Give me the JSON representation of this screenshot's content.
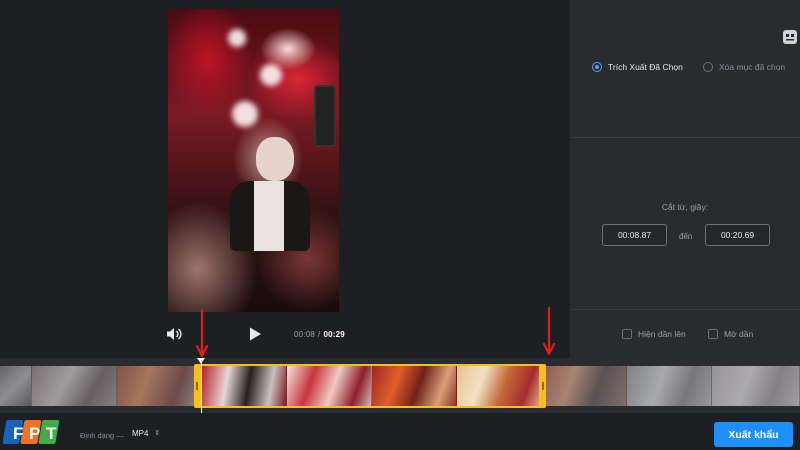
{
  "player": {
    "current_time": "00:08",
    "separator": "/",
    "total_time": "00:29"
  },
  "options": {
    "mode_extract_label": "Trích Xuất Đã Chọn",
    "mode_delete_label": "Xóa mục đã chọn",
    "selected_mode": "extract"
  },
  "cut": {
    "label": "Cắt từ, giây:",
    "start": "00:08.87",
    "to_label": "đến",
    "end": "00:20.69"
  },
  "effects": {
    "fade_in_label": "Hiện dần lên",
    "fade_out_label": "Mờ dần",
    "fade_in_checked": false,
    "fade_out_checked": false
  },
  "format": {
    "label": "Định dạng —",
    "value": "MP4"
  },
  "export": {
    "label": "Xuất khẩu"
  },
  "logo": {
    "letters": [
      "F",
      "P",
      "T"
    ]
  },
  "colors": {
    "accent": "#1f8fff",
    "selection": "#f2c21b",
    "annotation": "#e11d1d",
    "logo_blue": "#1664c0",
    "logo_orange": "#f27024",
    "logo_green": "#3fae49"
  }
}
